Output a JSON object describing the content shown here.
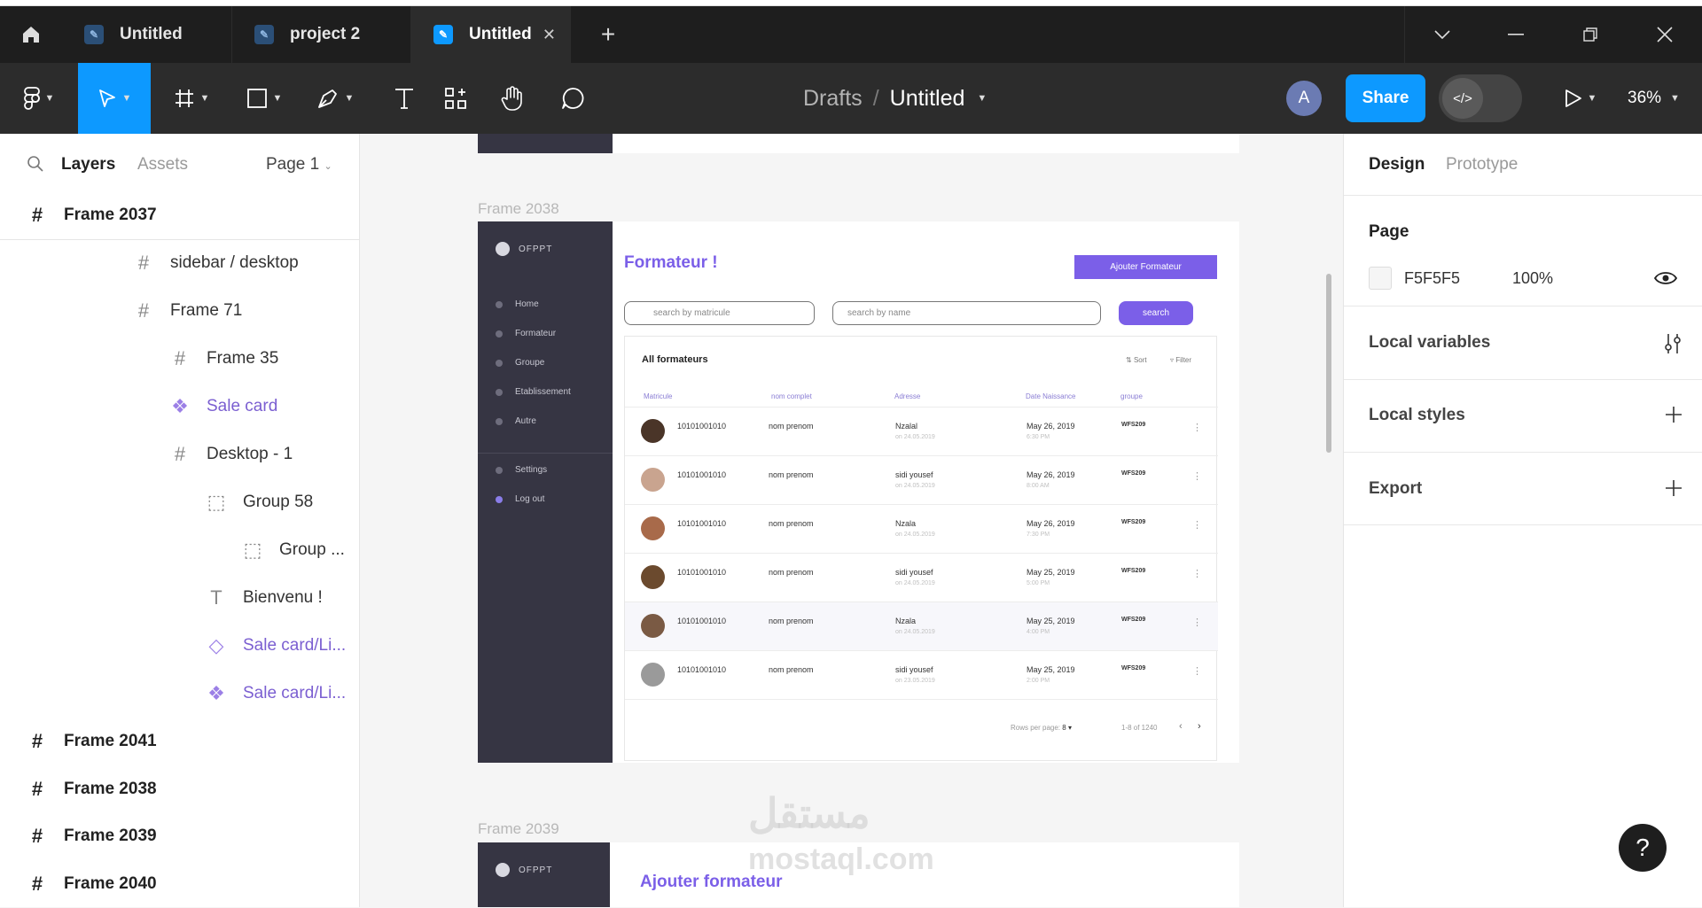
{
  "tabbar": {
    "tabs": [
      {
        "label": "Untitled",
        "active": false
      },
      {
        "label": "project 2",
        "active": false
      },
      {
        "label": "Untitled",
        "active": true
      }
    ],
    "new_tab": "+"
  },
  "toolbar": {
    "breadcrumb": {
      "parent": "Drafts",
      "separator": "/",
      "file": "Untitled"
    },
    "avatar_initial": "A",
    "share_label": "Share",
    "zoom": "36%"
  },
  "left_panel": {
    "tabs": {
      "layers": "Layers",
      "assets": "Assets"
    },
    "page_selector": "Page 1",
    "layers": [
      {
        "label": "Frame 2037",
        "icon": "frame-icon"
      },
      {
        "label": "sidebar / desktop",
        "icon": "frame-icon"
      },
      {
        "label": "Frame 71",
        "icon": "frame-icon"
      },
      {
        "label": "Frame 35",
        "icon": "frame-icon"
      },
      {
        "label": "Sale card",
        "icon": "component-icon"
      },
      {
        "label": "Desktop - 1",
        "icon": "frame-icon"
      },
      {
        "label": "Group 58",
        "icon": "group-icon"
      },
      {
        "label": "Group ...",
        "icon": "group-icon"
      },
      {
        "label": "Bienvenu !",
        "icon": "text-icon"
      },
      {
        "label": "Sale card/Li...",
        "icon": "instance-icon"
      },
      {
        "label": "Sale card/Li...",
        "icon": "component-icon"
      },
      {
        "label": "Frame 2041",
        "icon": "frame-icon"
      },
      {
        "label": "Frame 2038",
        "icon": "frame-icon"
      },
      {
        "label": "Frame 2039",
        "icon": "frame-icon"
      },
      {
        "label": "Frame 2040",
        "icon": "frame-icon"
      }
    ]
  },
  "canvas": {
    "frame_2038_label": "Frame 2038",
    "frame_2039_label": "Frame 2039",
    "app": {
      "logo": "OFPPT",
      "title": "Formateur !",
      "add_button": "Ajouter Formateur",
      "search_matricule_placeholder": "search by matricule",
      "search_name_placeholder": "search by name",
      "search_button": "search",
      "nav": [
        "Home",
        "Formateur",
        "Groupe",
        "Etablissement",
        "Autre",
        "Settings",
        "Log out"
      ],
      "table_title": "All formateurs",
      "sort": "Sort",
      "filter": "Filter",
      "columns": [
        "Matricule",
        "nom complet",
        "Adresse",
        "Date Naissance",
        "groupe"
      ],
      "rows": [
        {
          "matricule": "10101001010",
          "nom": "nom prenom",
          "adresse": "Nzalal",
          "adresse_sub": "on 24.05.2019",
          "date": "May 26, 2019",
          "date_sub": "6:30 PM",
          "groupe": "WFS209"
        },
        {
          "matricule": "10101001010",
          "nom": "nom prenom",
          "adresse": "sidi yousef",
          "adresse_sub": "on 24.05.2019",
          "date": "May 26, 2019",
          "date_sub": "8:00 AM",
          "groupe": "WFS209"
        },
        {
          "matricule": "10101001010",
          "nom": "nom prenom",
          "adresse": "Nzala",
          "adresse_sub": "on 24.05.2019",
          "date": "May 26, 2019",
          "date_sub": "7:30 PM",
          "groupe": "WFS209"
        },
        {
          "matricule": "10101001010",
          "nom": "nom prenom",
          "adresse": "sidi yousef",
          "adresse_sub": "on 24.05.2019",
          "date": "May 25, 2019",
          "date_sub": "5:00 PM",
          "groupe": "WFS209"
        },
        {
          "matricule": "10101001010",
          "nom": "nom prenom",
          "adresse": "Nzala",
          "adresse_sub": "on 24.05.2019",
          "date": "May 25, 2019",
          "date_sub": "4:00 PM",
          "groupe": "WFS209"
        },
        {
          "matricule": "10101001010",
          "nom": "nom prenom",
          "adresse": "sidi yousef",
          "adresse_sub": "on 23.05.2019",
          "date": "May 25, 2019",
          "date_sub": "2:00 PM",
          "groupe": "WFS209"
        }
      ],
      "rows_per_page_label": "Rows per page:",
      "rows_per_page_value": "8",
      "range": "1-8 of 1240",
      "second_frame_title": "Ajouter formateur"
    },
    "watermark_arabic": "مستقل",
    "watermark_latin": "mostaql.com"
  },
  "right_panel": {
    "tabs": {
      "design": "Design",
      "prototype": "Prototype"
    },
    "page_section": {
      "title": "Page",
      "color": "F5F5F5",
      "opacity": "100%"
    },
    "local_variables": "Local variables",
    "local_styles": "Local styles",
    "export": "Export"
  },
  "help": "?",
  "colors": {
    "accent": "#0d99ff",
    "brand_purple": "#7b5fe8",
    "sidebar_dark": "#363543",
    "chrome_dark": "#1e1e1e"
  }
}
